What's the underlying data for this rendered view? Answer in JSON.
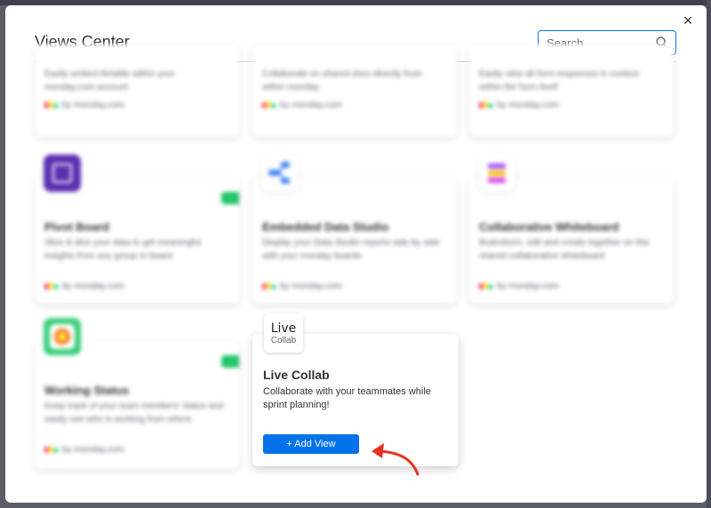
{
  "modal": {
    "title": "Views Center",
    "search_placeholder": "Search",
    "close_glyph": "×"
  },
  "cards_row1": [
    {
      "desc": "Easily embed Airtable within your monday.com account",
      "by": "by monday.com"
    },
    {
      "desc": "Collaborate on shared docs directly from within monday",
      "by": "by monday.com"
    },
    {
      "desc": "Easily view all form responses in context within the form itself",
      "by": "by monday.com"
    }
  ],
  "cards_row2": [
    {
      "name": "Pivot Board",
      "desc": "Slice & dice your data to get meaningful insights from any group or board",
      "by": "by monday.com",
      "icon": "pivot-board-icon"
    },
    {
      "name": "Embedded Data Studio",
      "desc": "Display your Data Studio reports side by side with your monday boards",
      "by": "by monday.com",
      "icon": "data-studio-icon"
    },
    {
      "name": "Collaborative Whiteboard",
      "desc": "Brainstorm, edit and create together on this shared collaborative whiteboard",
      "by": "by monday.com",
      "icon": "whiteboard-icon"
    }
  ],
  "cards_row3": [
    {
      "name": "Working Status",
      "desc": "Keep track of your team members' status and easily see who is working from where",
      "by": "by monday.com",
      "icon": "working-status-icon"
    }
  ],
  "live_collab": {
    "logo_line1": "Live",
    "logo_line2": "Collab",
    "name": "Live Collab",
    "desc": "Collaborate with your teammates while sprint planning!",
    "button": "+ Add View"
  },
  "colors": {
    "accent": "#0073ea",
    "toggle_green": "#21c568",
    "arrow_red": "#e8301f",
    "brand_red": "#f62b54",
    "brand_yellow": "#ffcc00",
    "brand_green": "#00ca72"
  }
}
